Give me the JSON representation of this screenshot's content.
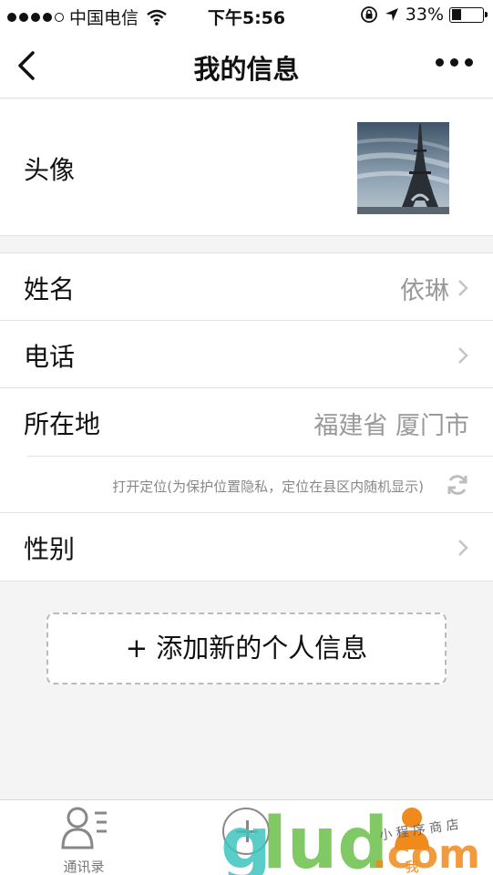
{
  "status_bar": {
    "carrier": "中国电信",
    "time": "下午5:56",
    "battery_percent_label": "33%",
    "battery_level": 0.33,
    "icons": [
      "signal-dots-icon",
      "wifi-icon",
      "orientation-lock-icon",
      "location-arrow-icon",
      "battery-icon"
    ]
  },
  "nav": {
    "title": "我的信息",
    "back_icon": "chevron-left-icon",
    "more_icon": "more-dots-icon"
  },
  "avatar": {
    "label": "头像",
    "image": "eiffel-tower-photo"
  },
  "fields": {
    "name": {
      "label": "姓名",
      "value": "依琳"
    },
    "phone": {
      "label": "电话",
      "value": ""
    },
    "location": {
      "label": "所在地",
      "value": "福建省 厦门市"
    },
    "location_hint": "打开定位(为保护位置隐私，定位在县区内随机显示)",
    "gender": {
      "label": "性别",
      "value": ""
    }
  },
  "add_button": {
    "label": "+ 添加新的个人信息"
  },
  "tabbar": {
    "items": [
      {
        "label": "通讯录",
        "icon": "contacts-icon"
      },
      {
        "label": "",
        "icon": "add-circle-icon"
      },
      {
        "label": "我",
        "icon": "me-icon"
      }
    ]
  },
  "colors": {
    "accent_orange": "#f08a1c",
    "watermark_teal": "#3ec5c0",
    "watermark_green": "#6cc04a",
    "muted_text": "#999999"
  }
}
